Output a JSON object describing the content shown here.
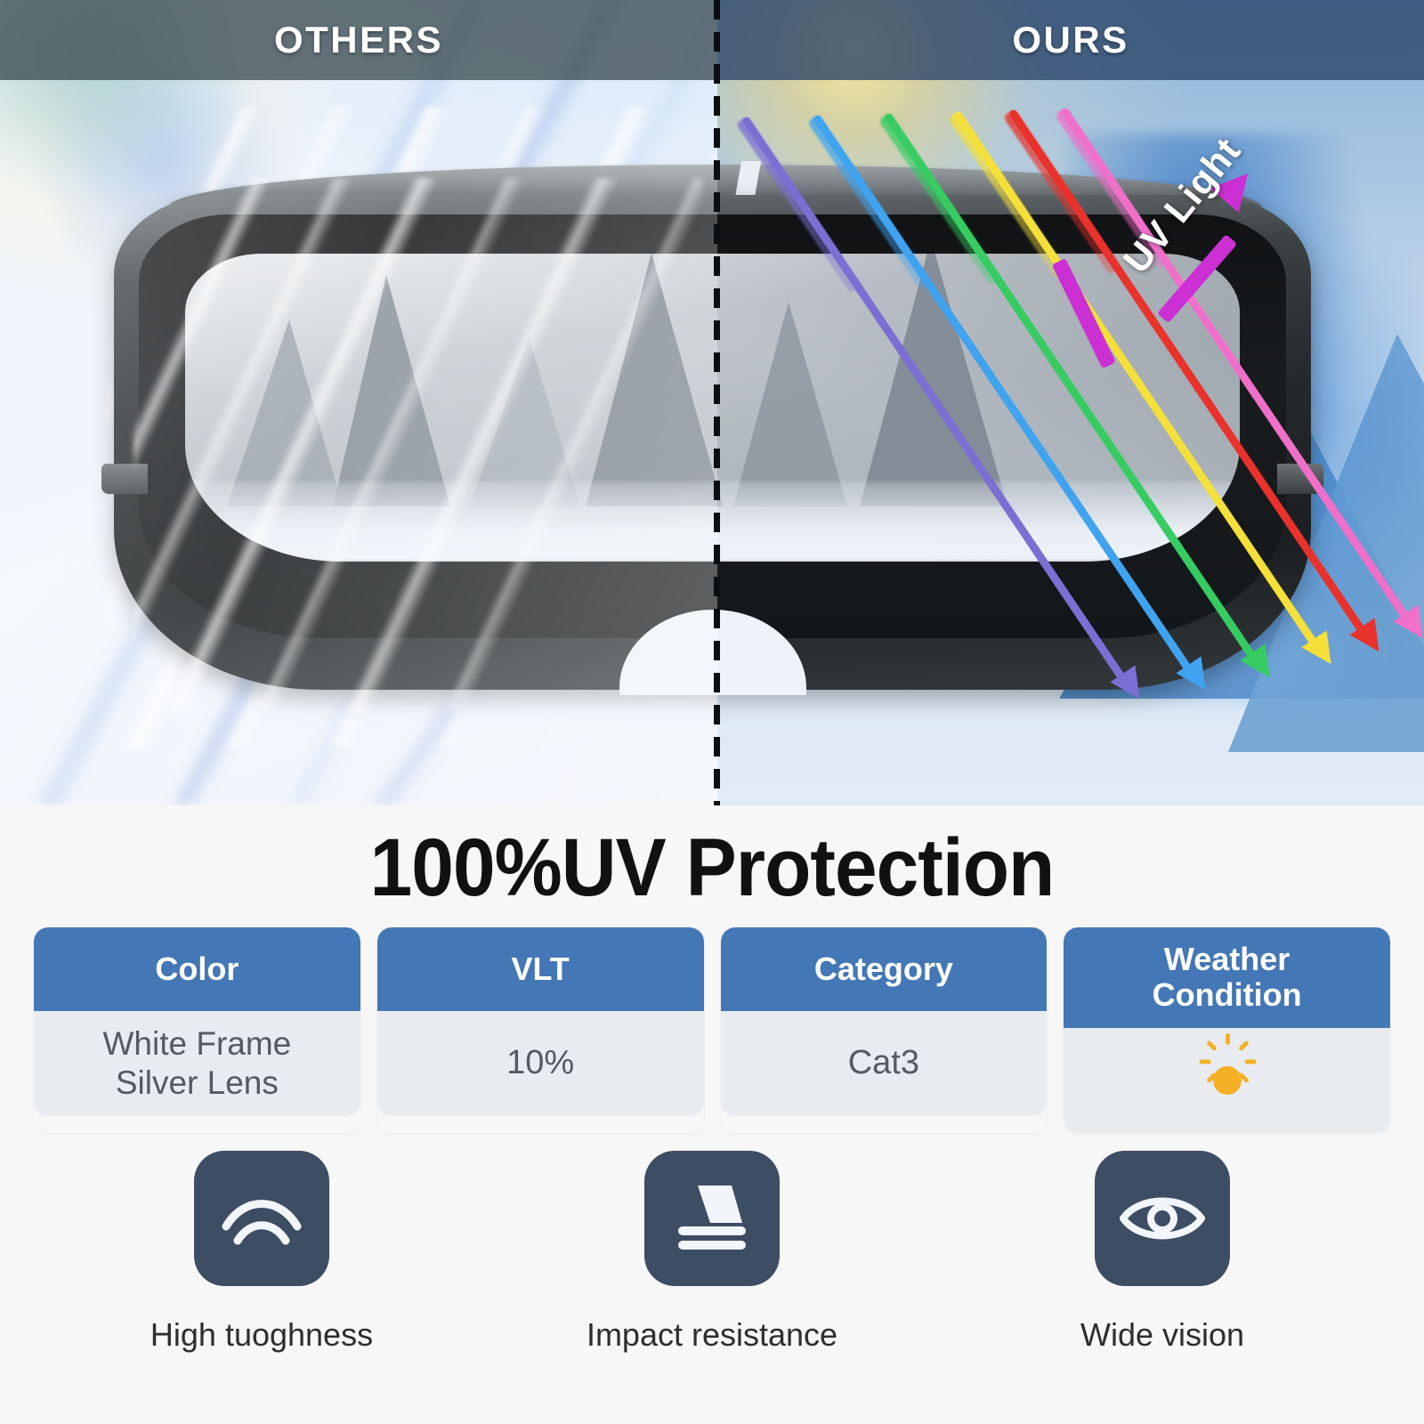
{
  "comparison": {
    "left": {
      "title": "OTHERS",
      "side": "others"
    },
    "right": {
      "title": "OURS",
      "side": "ours"
    },
    "uv_label": "UV Light",
    "divider_style": "dashed",
    "ray_colors": [
      "#7b6fd4",
      "#3fa3f0",
      "#36cc62",
      "#f5e03a",
      "#e8322b",
      "#ef6fc9"
    ],
    "uv_arrow_color": "#cc2fd4"
  },
  "headline": "100%UV Protection",
  "specs": [
    {
      "label": "Color",
      "value": "White Frame\nSilver Lens",
      "value_line1": "White Frame",
      "value_line2": "Silver Lens",
      "type": "text"
    },
    {
      "label": "VLT",
      "value": "10%",
      "type": "text"
    },
    {
      "label": "Category",
      "value": "Cat3",
      "type": "text"
    },
    {
      "label": "Weather\nCondition",
      "label_line1": "Weather",
      "label_line2": "Condition",
      "value": "",
      "type": "icon",
      "icon": "sun-icon"
    }
  ],
  "features": [
    {
      "label": "High tuoghness",
      "icon": "arcs-icon"
    },
    {
      "label": "Impact resistance",
      "icon": "impact-layers-icon"
    },
    {
      "label": "Wide vision",
      "icon": "eye-icon"
    }
  ],
  "colors": {
    "card_header": "#4477b5",
    "card_body": "#e8ebf0",
    "feature_icon_bg": "#3d4d63",
    "sun": "#f5b125",
    "page_bg": "#f7f7f7",
    "headline": "#111111"
  }
}
